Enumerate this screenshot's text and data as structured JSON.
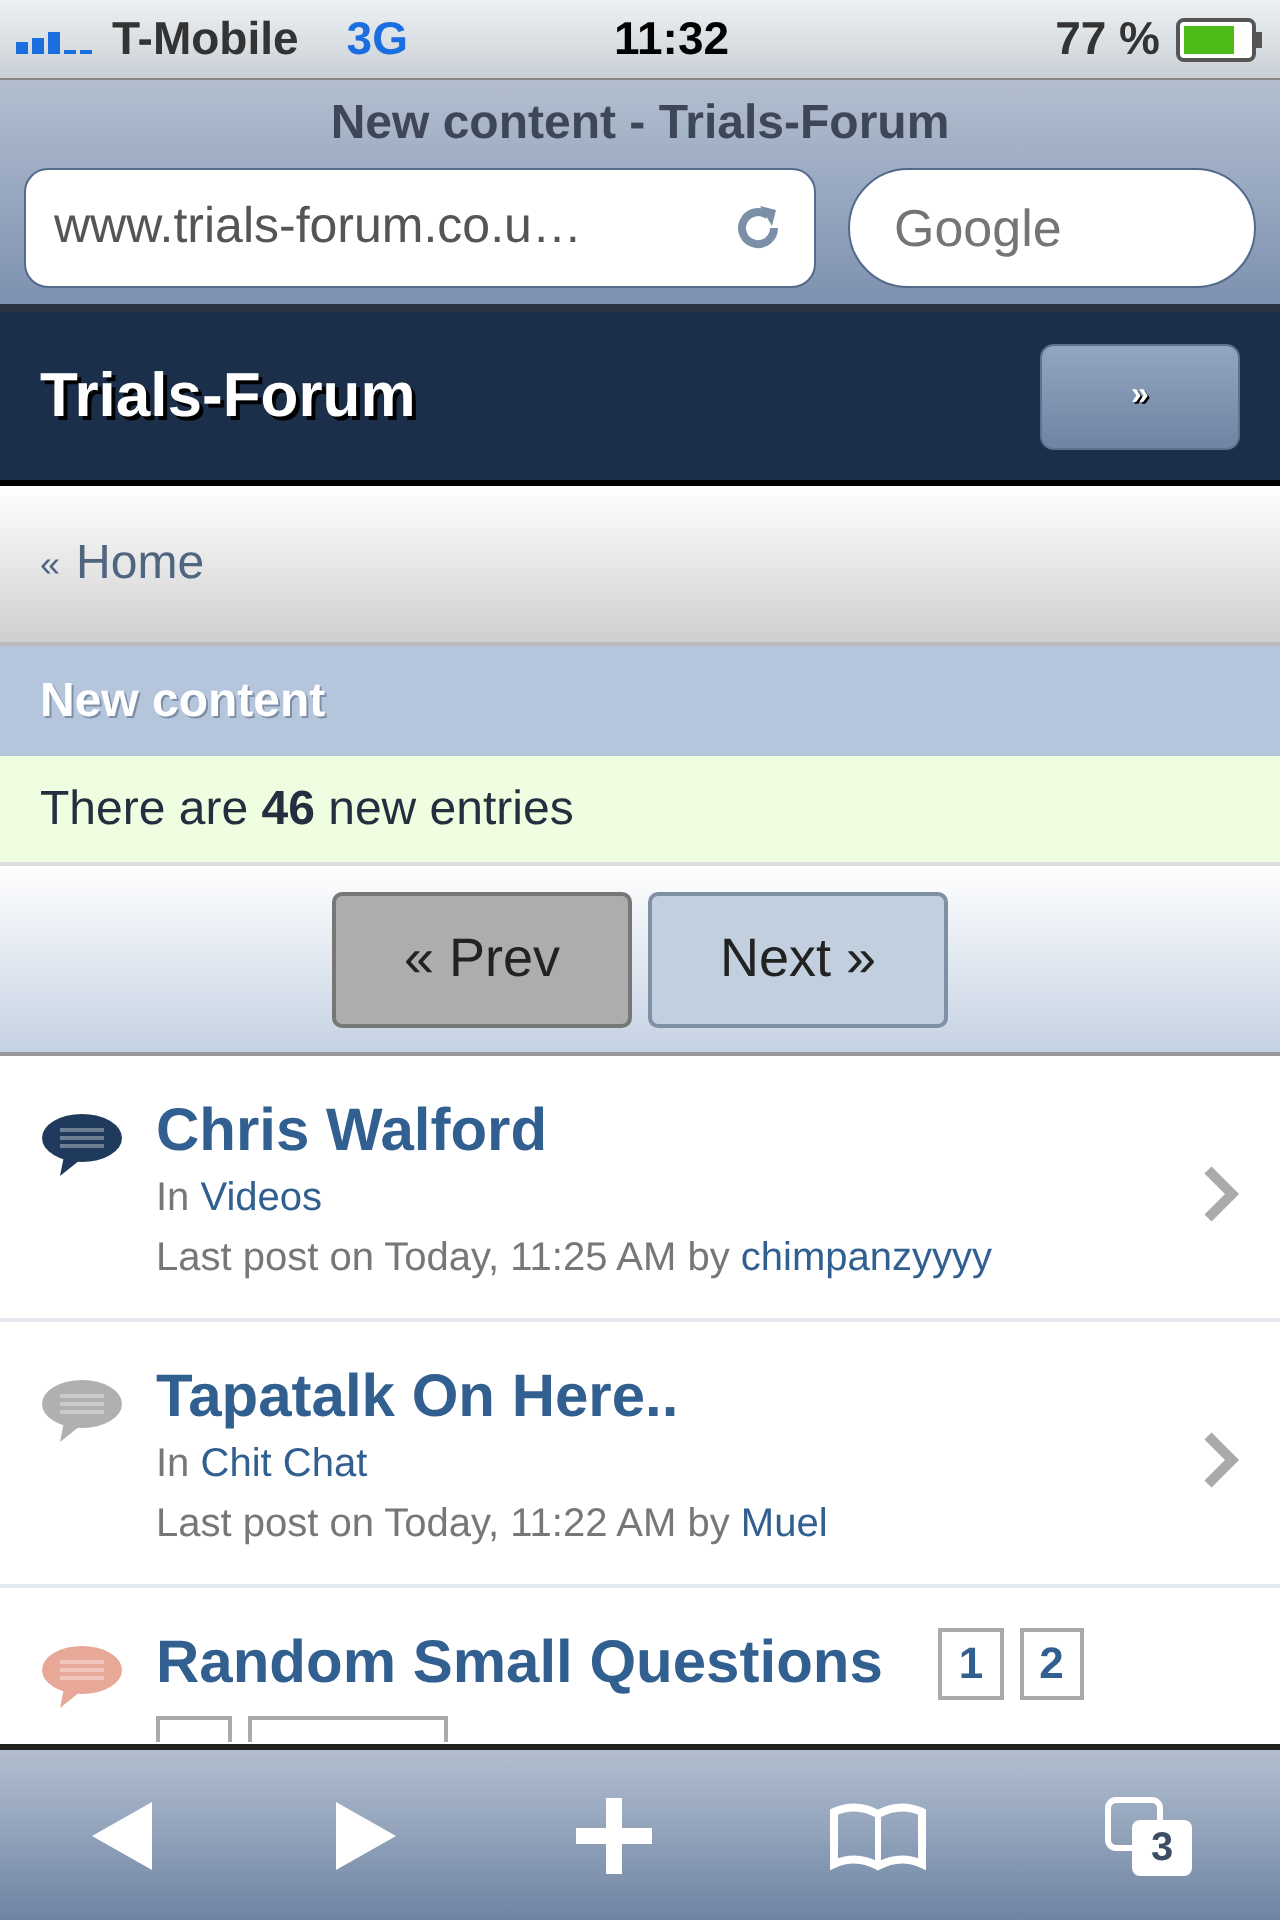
{
  "status_bar": {
    "carrier": "T-Mobile",
    "network": "3G",
    "time": "11:32",
    "battery": "77 %"
  },
  "browser": {
    "title": "New content - Trials-Forum",
    "url": "www.trials-forum.co.u…",
    "search_placeholder": "Google",
    "tab_count": "3"
  },
  "header": {
    "title": "Trials-Forum",
    "menu_button": "»"
  },
  "breadcrumb": {
    "arrow": "«",
    "label": "Home"
  },
  "section": {
    "title": "New content",
    "info": "There are **46** new entries"
  },
  "pagination": [
    {
      "label": "« Prev",
      "disabled": true
    },
    {
      "label": "Next »",
      "disabled": false
    }
  ],
  "topics": [
    {
      "title": "Chris Walford",
      "in_label": "In",
      "forum": "Videos",
      "last_post": "Last post on Today, 11:25 AM by",
      "author": "chimpanzyyyy",
      "color": "#1f3a5c"
    },
    {
      "title": "Tapatalk On Here..",
      "in_label": "In",
      "forum": "Chit Chat",
      "last_post": "Last post on Today, 11:22 AM by",
      "author": "Muel",
      "color": "#b0b0b0"
    },
    {
      "title": "Random Small Questions",
      "color": "#e8a898",
      "pages": [
        "1",
        "2"
      ]
    }
  ]
}
